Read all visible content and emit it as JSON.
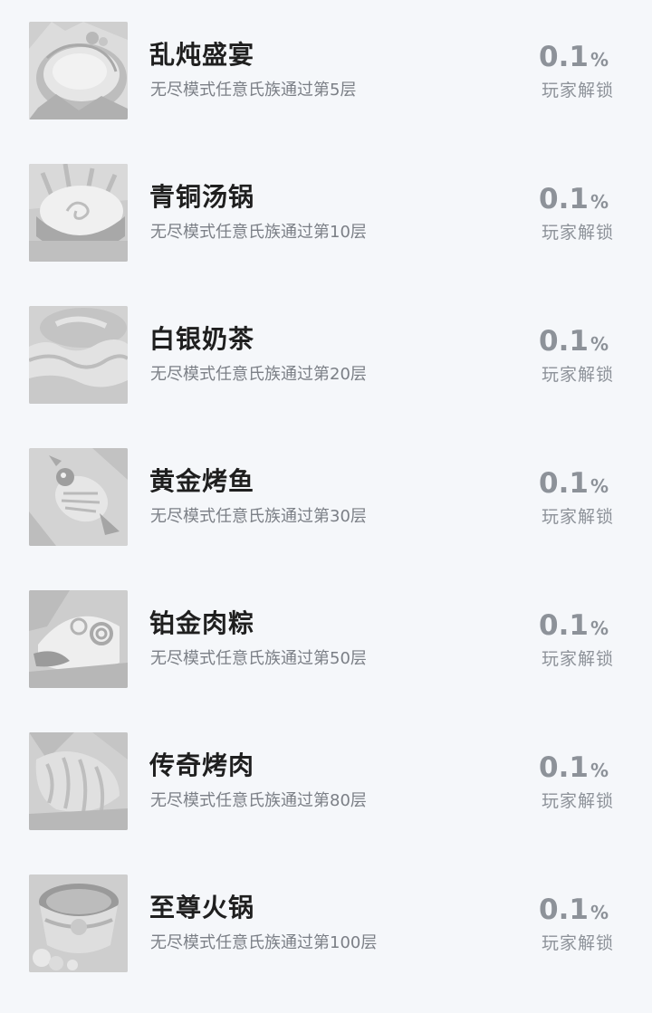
{
  "achievements": [
    {
      "title": "乱炖盛宴",
      "subtitle": "无尽模式任意氏族通过第5层",
      "percent": "0.1",
      "percent_sign": "%",
      "status": "玩家解锁",
      "icon": "stew-feast-icon"
    },
    {
      "title": "青铜汤锅",
      "subtitle": "无尽模式任意氏族通过第10层",
      "percent": "0.1",
      "percent_sign": "%",
      "status": "玩家解锁",
      "icon": "bronze-soup-pot-icon"
    },
    {
      "title": "白银奶茶",
      "subtitle": "无尽模式任意氏族通过第20层",
      "percent": "0.1",
      "percent_sign": "%",
      "status": "玩家解锁",
      "icon": "silver-milk-tea-icon"
    },
    {
      "title": "黄金烤鱼",
      "subtitle": "无尽模式任意氏族通过第30层",
      "percent": "0.1",
      "percent_sign": "%",
      "status": "玩家解锁",
      "icon": "golden-grilled-fish-icon"
    },
    {
      "title": "铂金肉粽",
      "subtitle": "无尽模式任意氏族通过第50层",
      "percent": "0.1",
      "percent_sign": "%",
      "status": "玩家解锁",
      "icon": "platinum-meat-dumpling-icon"
    },
    {
      "title": "传奇烤肉",
      "subtitle": "无尽模式任意氏族通过第80层",
      "percent": "0.1",
      "percent_sign": "%",
      "status": "玩家解锁",
      "icon": "legendary-roast-meat-icon"
    },
    {
      "title": "至尊火锅",
      "subtitle": "无尽模式任意氏族通过第100层",
      "percent": "0.1",
      "percent_sign": "%",
      "status": "玩家解锁",
      "icon": "supreme-hotpot-icon"
    }
  ]
}
